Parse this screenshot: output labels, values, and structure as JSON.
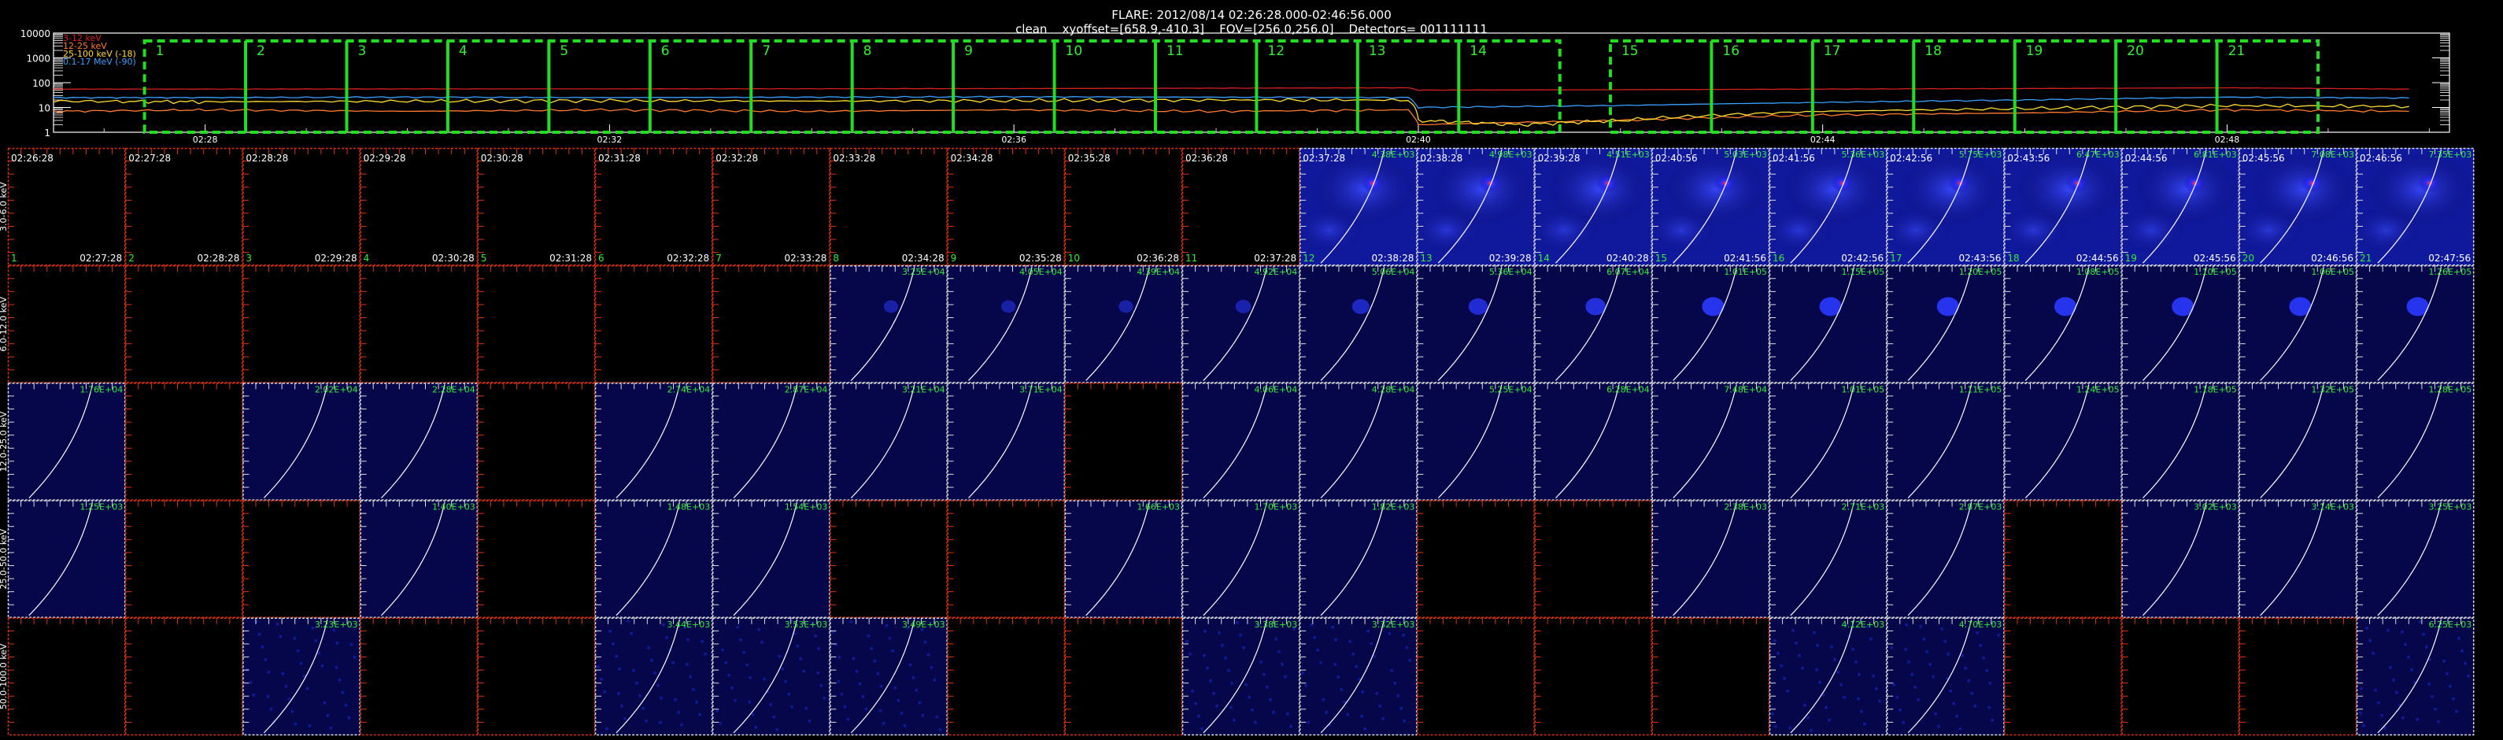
{
  "header": {
    "line1": "FLARE: 2012/08/14 02:26:28.000-02:46:56.000",
    "line2": "clean    xyoffset=[658.9,-410.3]    FOV=[256.0,256.0]    Detectors= 001111111"
  },
  "colors": {
    "bg": "#000000",
    "axis": "#ffffff",
    "interval_box": "#22dd22",
    "label_green": "#33ee33",
    "panel_border_red": "#dd3311",
    "panel_border_white": "#dddddd",
    "series_3_12": "#d62020",
    "series_12_25": "#ff7a30",
    "series_25_100": "#ffdd33",
    "series_100_17000": "#3aa0ff"
  },
  "chart_data": [
    {
      "type": "line",
      "ylim": [
        1,
        10000
      ],
      "log_y": true,
      "ytick_labels": [
        "10000",
        "1000",
        "100",
        "10",
        "1"
      ],
      "xtick_labels": [
        "02:28",
        "02:32",
        "02:36",
        "02:40",
        "02:44",
        "02:48"
      ],
      "xrange_minutes": [
        26.5,
        50.2
      ],
      "xticks_minutes": [
        28,
        32,
        36,
        40,
        44,
        48
      ],
      "legend": {
        "placement": "top-left",
        "entries": [
          "3-12 keV",
          "12-25 keV",
          "25-100 keV (-18)",
          "0.1-17 MeV (-90)"
        ]
      },
      "series": [
        {
          "name": "3-12 keV",
          "x": [
            26.5,
            28,
            30,
            32,
            34,
            36,
            38,
            39.9,
            40.0,
            42,
            44,
            46,
            48,
            49.8
          ],
          "values": [
            55,
            55,
            56,
            56,
            57,
            58,
            60,
            62,
            50,
            52,
            55,
            58,
            62,
            55
          ]
        },
        {
          "name": "12-25 keV",
          "x": [
            26.5,
            28,
            30,
            32,
            34,
            36,
            38,
            39.9,
            40.0,
            42,
            44,
            46,
            48,
            49.8
          ],
          "values": [
            7,
            8,
            7,
            8,
            7,
            8,
            7,
            8,
            2,
            3,
            5,
            6,
            8,
            7
          ]
        },
        {
          "name": "25-100 keV (-18)",
          "x": [
            26.5,
            28,
            30,
            32,
            34,
            36,
            38,
            39.9,
            40.0,
            41,
            42,
            44,
            46,
            48,
            49.8
          ],
          "values": [
            18,
            17,
            18,
            19,
            18,
            19,
            20,
            20,
            3,
            2,
            3,
            7,
            9,
            12,
            11
          ]
        },
        {
          "name": "0.1-17 MeV (-90)",
          "x": [
            26.5,
            28,
            30,
            32,
            34,
            36,
            38,
            39.9,
            40.0,
            42,
            44,
            46,
            48,
            49.8
          ],
          "values": [
            25,
            25,
            26,
            25,
            26,
            27,
            26,
            25,
            10,
            12,
            16,
            20,
            26,
            24
          ]
        }
      ],
      "intervals": {
        "labels": [
          "1",
          "2",
          "3",
          "4",
          "5",
          "6",
          "7",
          "8",
          "9",
          "10",
          "11",
          "12",
          "13",
          "14",
          "15",
          "16",
          "17",
          "18",
          "19",
          "20",
          "21"
        ],
        "ranges_minutes": [
          [
            27.4,
            28.4
          ],
          [
            28.4,
            29.4
          ],
          [
            29.4,
            30.4
          ],
          [
            30.4,
            31.4
          ],
          [
            31.4,
            32.4
          ],
          [
            32.4,
            33.4
          ],
          [
            33.4,
            34.4
          ],
          [
            34.4,
            35.4
          ],
          [
            35.4,
            36.4
          ],
          [
            36.4,
            37.4
          ],
          [
            37.4,
            38.4
          ],
          [
            38.4,
            39.4
          ],
          [
            39.4,
            40.4
          ],
          [
            40.4,
            41.4
          ],
          [
            41.9,
            42.9
          ],
          [
            42.9,
            43.9
          ],
          [
            43.9,
            44.9
          ],
          [
            44.9,
            45.9
          ],
          [
            45.9,
            46.9
          ],
          [
            46.9,
            47.9
          ],
          [
            47.9,
            48.9
          ]
        ]
      }
    },
    {
      "type": "heatmap",
      "rows": [
        {
          "energy": "3.0-6.0 keV"
        },
        {
          "energy": "6.0-12.0 keV"
        },
        {
          "energy": "12.0-25.0 keV"
        },
        {
          "energy": "25.0-50.0 keV"
        },
        {
          "energy": "50.0-100.0 keV"
        }
      ],
      "columns": [
        {
          "start": "02:26:28",
          "end": "02:27:28",
          "num": "1"
        },
        {
          "start": "02:27:28",
          "end": "02:28:28",
          "num": "2"
        },
        {
          "start": "02:28:28",
          "end": "02:29:28",
          "num": "3"
        },
        {
          "start": "02:29:28",
          "end": "02:30:28",
          "num": "4"
        },
        {
          "start": "02:30:28",
          "end": "02:31:28",
          "num": "5"
        },
        {
          "start": "02:31:28",
          "end": "02:32:28",
          "num": "6"
        },
        {
          "start": "02:32:28",
          "end": "02:33:28",
          "num": "7"
        },
        {
          "start": "02:33:28",
          "end": "02:34:28",
          "num": "8"
        },
        {
          "start": "02:34:28",
          "end": "02:35:28",
          "num": "9"
        },
        {
          "start": "02:35:28",
          "end": "02:36:28",
          "num": "10"
        },
        {
          "start": "02:36:28",
          "end": "02:37:28",
          "num": "11"
        },
        {
          "start": "02:37:28",
          "end": "02:38:28",
          "num": "12"
        },
        {
          "start": "02:38:28",
          "end": "02:39:28",
          "num": "13"
        },
        {
          "start": "02:39:28",
          "end": "02:40:28",
          "num": "14"
        },
        {
          "start": "02:40:56",
          "end": "02:41:56",
          "num": "15"
        },
        {
          "start": "02:41:56",
          "end": "02:42:56",
          "num": "16"
        },
        {
          "start": "02:42:56",
          "end": "02:43:56",
          "num": "17"
        },
        {
          "start": "02:43:56",
          "end": "02:44:56",
          "num": "18"
        },
        {
          "start": "02:44:56",
          "end": "02:45:56",
          "num": "19"
        },
        {
          "start": "02:45:56",
          "end": "02:46:56",
          "num": "20"
        },
        {
          "start": "02:46:56",
          "end": "02:47:56",
          "num": "21"
        }
      ],
      "cells": [
        [
          {
            "img": false,
            "max": ""
          },
          {
            "img": false,
            "max": ""
          },
          {
            "img": false,
            "max": ""
          },
          {
            "img": false,
            "max": ""
          },
          {
            "img": false,
            "max": ""
          },
          {
            "img": false,
            "max": ""
          },
          {
            "img": false,
            "max": ""
          },
          {
            "img": false,
            "max": ""
          },
          {
            "img": false,
            "max": ""
          },
          {
            "img": false,
            "max": ""
          },
          {
            "img": false,
            "max": ""
          },
          {
            "img": true,
            "max": "4.38E+03",
            "strength": 0.75
          },
          {
            "img": true,
            "max": "4.98E+03",
            "strength": 0.85
          },
          {
            "img": true,
            "max": "4.51E+03",
            "strength": 0.85
          },
          {
            "img": true,
            "max": "5.03E+03",
            "strength": 0.85
          },
          {
            "img": true,
            "max": "5.36E+03",
            "strength": 0.85
          },
          {
            "img": true,
            "max": "5.75E+03",
            "strength": 0.9
          },
          {
            "img": true,
            "max": "6.47E+03",
            "strength": 0.9
          },
          {
            "img": true,
            "max": "6.81E+03",
            "strength": 0.9
          },
          {
            "img": true,
            "max": "7.08E+03",
            "strength": 0.9
          },
          {
            "img": true,
            "max": "7.35E+03",
            "strength": 0.9
          }
        ],
        [
          {
            "img": false,
            "max": ""
          },
          {
            "img": false,
            "max": ""
          },
          {
            "img": false,
            "max": ""
          },
          {
            "img": false,
            "max": ""
          },
          {
            "img": false,
            "max": ""
          },
          {
            "img": false,
            "max": ""
          },
          {
            "img": false,
            "max": ""
          },
          {
            "img": true,
            "max": "3.25E+04",
            "strength": 0.1
          },
          {
            "img": true,
            "max": "4.05E+04",
            "strength": 0.1
          },
          {
            "img": true,
            "max": "4.39E+04",
            "strength": 0.1
          },
          {
            "img": true,
            "max": "4.92E+04",
            "strength": 0.15
          },
          {
            "img": true,
            "max": "5.06E+04",
            "strength": 0.25
          },
          {
            "img": true,
            "max": "5.36E+04",
            "strength": 0.35
          },
          {
            "img": true,
            "max": "6.07E+04",
            "strength": 0.4
          },
          {
            "img": true,
            "max": "1.01E+05",
            "strength": 0.5
          },
          {
            "img": true,
            "max": "1.15E+05",
            "strength": 0.5
          },
          {
            "img": true,
            "max": "1.20E+05",
            "strength": 0.5
          },
          {
            "img": true,
            "max": "1.08E+05",
            "strength": 0.5
          },
          {
            "img": true,
            "max": "1.10E+05",
            "strength": 0.5
          },
          {
            "img": true,
            "max": "1.06E+05",
            "strength": 0.5
          },
          {
            "img": true,
            "max": "1.26E+05",
            "strength": 0.5
          }
        ],
        [
          {
            "img": true,
            "max": "1.76E+04",
            "strength": 0.05
          },
          {
            "img": false,
            "max": ""
          },
          {
            "img": true,
            "max": "2.02E+04",
            "strength": 0.05
          },
          {
            "img": true,
            "max": "2.28E+04",
            "strength": 0.05
          },
          {
            "img": false,
            "max": ""
          },
          {
            "img": true,
            "max": "2.74E+04",
            "strength": 0.05
          },
          {
            "img": true,
            "max": "2.87E+04",
            "strength": 0.05
          },
          {
            "img": true,
            "max": "3.21E+04",
            "strength": 0.05
          },
          {
            "img": true,
            "max": "3.71E+04",
            "strength": 0.05
          },
          {
            "img": false,
            "max": ""
          },
          {
            "img": true,
            "max": "4.06E+04",
            "strength": 0.05
          },
          {
            "img": true,
            "max": "4.28E+04",
            "strength": 0.05
          },
          {
            "img": true,
            "max": "5.25E+04",
            "strength": 0.05
          },
          {
            "img": true,
            "max": "6.28E+04",
            "strength": 0.05
          },
          {
            "img": true,
            "max": "7.48E+04",
            "strength": 0.05
          },
          {
            "img": true,
            "max": "1.01E+05",
            "strength": 0.05
          },
          {
            "img": true,
            "max": "1.11E+05",
            "strength": 0.05
          },
          {
            "img": true,
            "max": "1.24E+05",
            "strength": 0.05
          },
          {
            "img": true,
            "max": "1.18E+05",
            "strength": 0.05
          },
          {
            "img": true,
            "max": "1.32E+05",
            "strength": 0.05
          },
          {
            "img": true,
            "max": "1.28E+05",
            "strength": 0.05
          }
        ],
        [
          {
            "img": true,
            "max": "1.25E+03",
            "strength": 0.05
          },
          {
            "img": false,
            "max": ""
          },
          {
            "img": false,
            "max": ""
          },
          {
            "img": true,
            "max": "1.40E+03",
            "strength": 0.05
          },
          {
            "img": false,
            "max": ""
          },
          {
            "img": true,
            "max": "1.48E+03",
            "strength": 0.05
          },
          {
            "img": true,
            "max": "1.54E+03",
            "strength": 0.05
          },
          {
            "img": false,
            "max": ""
          },
          {
            "img": false,
            "max": ""
          },
          {
            "img": true,
            "max": "1.66E+03",
            "strength": 0.05
          },
          {
            "img": true,
            "max": "1.70E+03",
            "strength": 0.05
          },
          {
            "img": true,
            "max": "1.82E+03",
            "strength": 0.05
          },
          {
            "img": false,
            "max": ""
          },
          {
            "img": false,
            "max": ""
          },
          {
            "img": true,
            "max": "2.38E+03",
            "strength": 0.05
          },
          {
            "img": true,
            "max": "2.71E+03",
            "strength": 0.05
          },
          {
            "img": true,
            "max": "2.87E+03",
            "strength": 0.05
          },
          {
            "img": false,
            "max": ""
          },
          {
            "img": true,
            "max": "3.02E+03",
            "strength": 0.05
          },
          {
            "img": true,
            "max": "3.14E+03",
            "strength": 0.05
          },
          {
            "img": true,
            "max": "3.25E+03",
            "strength": 0.05
          }
        ],
        [
          {
            "img": false,
            "max": ""
          },
          {
            "img": false,
            "max": ""
          },
          {
            "img": true,
            "max": "3.23E+03",
            "strength": 0.05,
            "noise": true
          },
          {
            "img": false,
            "max": ""
          },
          {
            "img": false,
            "max": ""
          },
          {
            "img": true,
            "max": "3.44E+03",
            "strength": 0.05,
            "noise": true
          },
          {
            "img": true,
            "max": "3.53E+03",
            "strength": 0.05,
            "noise": true
          },
          {
            "img": true,
            "max": "3.49E+03",
            "strength": 0.05,
            "noise": true
          },
          {
            "img": false,
            "max": ""
          },
          {
            "img": false,
            "max": ""
          },
          {
            "img": true,
            "max": "3.38E+03",
            "strength": 0.05,
            "noise": true
          },
          {
            "img": true,
            "max": "3.32E+03",
            "strength": 0.05,
            "noise": true
          },
          {
            "img": false,
            "max": ""
          },
          {
            "img": false,
            "max": ""
          },
          {
            "img": false,
            "max": ""
          },
          {
            "img": true,
            "max": "4.12E+03",
            "strength": 0.05,
            "noise": true
          },
          {
            "img": true,
            "max": "4.70E+03",
            "strength": 0.05,
            "noise": true
          },
          {
            "img": false,
            "max": ""
          },
          {
            "img": false,
            "max": ""
          },
          {
            "img": false,
            "max": ""
          },
          {
            "img": true,
            "max": "6.25E+03",
            "strength": 0.05,
            "noise": true
          }
        ]
      ]
    }
  ]
}
